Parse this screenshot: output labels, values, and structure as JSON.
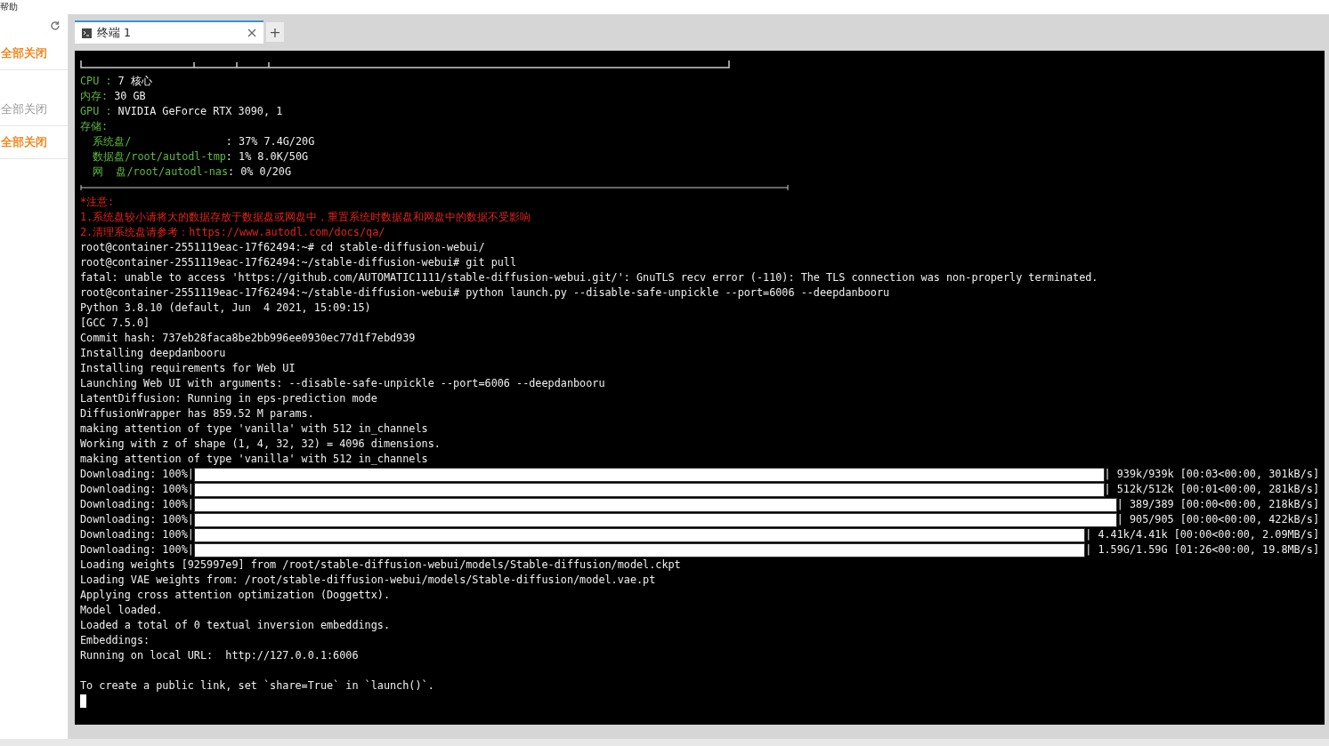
{
  "menu": {
    "label": "帮助"
  },
  "sidebar": {
    "items": [
      {
        "label": "全部关闭",
        "disabled": false
      },
      {
        "label": "全部关闭",
        "disabled": true
      },
      {
        "label": "全部关闭",
        "disabled": false
      }
    ]
  },
  "tabs": [
    {
      "label": "终端 1",
      "selected": true
    }
  ],
  "add_tab": {
    "label": "+"
  },
  "terminal": {
    "lines": [
      {
        "kind": "box"
      },
      {
        "kind": "info",
        "label": "CPU :",
        "value": " 7 核心"
      },
      {
        "kind": "info",
        "label": "内存:",
        "value": " 30 GB"
      },
      {
        "kind": "info",
        "label": "GPU :",
        "value": " NVIDIA GeForce RTX 3090, 1"
      },
      {
        "kind": "info",
        "label": "存储:"
      },
      {
        "kind": "info",
        "label": "  系统盘/",
        "value": "               : 37% 7.4G/20G"
      },
      {
        "kind": "info",
        "label": "  数据盘/root/autodl-tmp",
        "value": ": 1% 8.0K/50G"
      },
      {
        "kind": "info",
        "label": "  网  盘/root/autodl-nas",
        "value": ": 0% 0/20G"
      },
      {
        "kind": "rule"
      },
      {
        "kind": "warn",
        "text": "*注意:"
      },
      {
        "kind": "warn",
        "text": "1.系统盘较小请将大的数据存放于数据盘或网盘中，重置系统时数据盘和网盘中的数据不受影响"
      },
      {
        "kind": "warn",
        "text": "2.清理系统盘请参考：https://www.autodl.com/docs/qa/"
      },
      {
        "kind": "text",
        "text": "root@container-2551119eac-17f62494:~# cd stable-diffusion-webui/"
      },
      {
        "kind": "text",
        "text": "root@container-2551119eac-17f62494:~/stable-diffusion-webui# git pull"
      },
      {
        "kind": "text",
        "text": "fatal: unable to access 'https://github.com/AUTOMATIC1111/stable-diffusion-webui.git/': GnuTLS recv error (-110): The TLS connection was non-properly terminated."
      },
      {
        "kind": "text",
        "text": "root@container-2551119eac-17f62494:~/stable-diffusion-webui# python launch.py --disable-safe-unpickle --port=6006 --deepdanbooru"
      },
      {
        "kind": "text",
        "text": "Python 3.8.10 (default, Jun  4 2021, 15:09:15)"
      },
      {
        "kind": "text",
        "text": "[GCC 7.5.0]"
      },
      {
        "kind": "text",
        "text": "Commit hash: 737eb28faca8be2bb996ee0930ec77d1f7ebd939"
      },
      {
        "kind": "text",
        "text": "Installing deepdanbooru"
      },
      {
        "kind": "text",
        "text": "Installing requirements for Web UI"
      },
      {
        "kind": "text",
        "text": "Launching Web UI with arguments: --disable-safe-unpickle --port=6006 --deepdanbooru"
      },
      {
        "kind": "text",
        "text": "LatentDiffusion: Running in eps-prediction mode"
      },
      {
        "kind": "text",
        "text": "DiffusionWrapper has 859.52 M params."
      },
      {
        "kind": "text",
        "text": "making attention of type 'vanilla' with 512 in_channels"
      },
      {
        "kind": "text",
        "text": "Working with z of shape (1, 4, 32, 32) = 4096 dimensions."
      },
      {
        "kind": "text",
        "text": "making attention of type 'vanilla' with 512 in_channels"
      },
      {
        "kind": "progress",
        "label": "Downloading: 100%|",
        "level": 1,
        "reading": "| 939k/939k [00:03<00:00, 301kB/s]"
      },
      {
        "kind": "progress",
        "label": "Downloading: 100%|",
        "level": 1,
        "reading": "| 512k/512k [00:01<00:00, 281kB/s]"
      },
      {
        "kind": "progress",
        "label": "Downloading: 100%|",
        "level": 1,
        "reading": "| 389/389 [00:00<00:00, 218kB/s]"
      },
      {
        "kind": "progress",
        "label": "Downloading: 100%|",
        "level": 1,
        "reading": "| 905/905 [00:00<00:00, 422kB/s]"
      },
      {
        "kind": "progress",
        "label": "Downloading: 100%|",
        "level": 1,
        "reading": "| 4.41k/4.41k [00:00<00:00, 2.09MB/s]"
      },
      {
        "kind": "progress",
        "label": "Downloading: 100%|",
        "level": 1,
        "reading": "| 1.59G/1.59G [01:26<00:00, 19.8MB/s]"
      },
      {
        "kind": "text",
        "text": "Loading weights [925997e9] from /root/stable-diffusion-webui/models/Stable-diffusion/model.ckpt"
      },
      {
        "kind": "text",
        "text": "Loading VAE weights from: /root/stable-diffusion-webui/models/Stable-diffusion/model.vae.pt"
      },
      {
        "kind": "text",
        "text": "Applying cross attention optimization (Doggettx)."
      },
      {
        "kind": "text",
        "text": "Model loaded."
      },
      {
        "kind": "text",
        "text": "Loaded a total of 0 textual inversion embeddings."
      },
      {
        "kind": "text",
        "text": "Embeddings:"
      },
      {
        "kind": "text",
        "text": "Running on local URL:  http://127.0.0.1:6006"
      },
      {
        "kind": "blank"
      },
      {
        "kind": "text",
        "text": "To create a public link, set `share=True` in `launch()`."
      },
      {
        "kind": "cursor"
      }
    ]
  }
}
